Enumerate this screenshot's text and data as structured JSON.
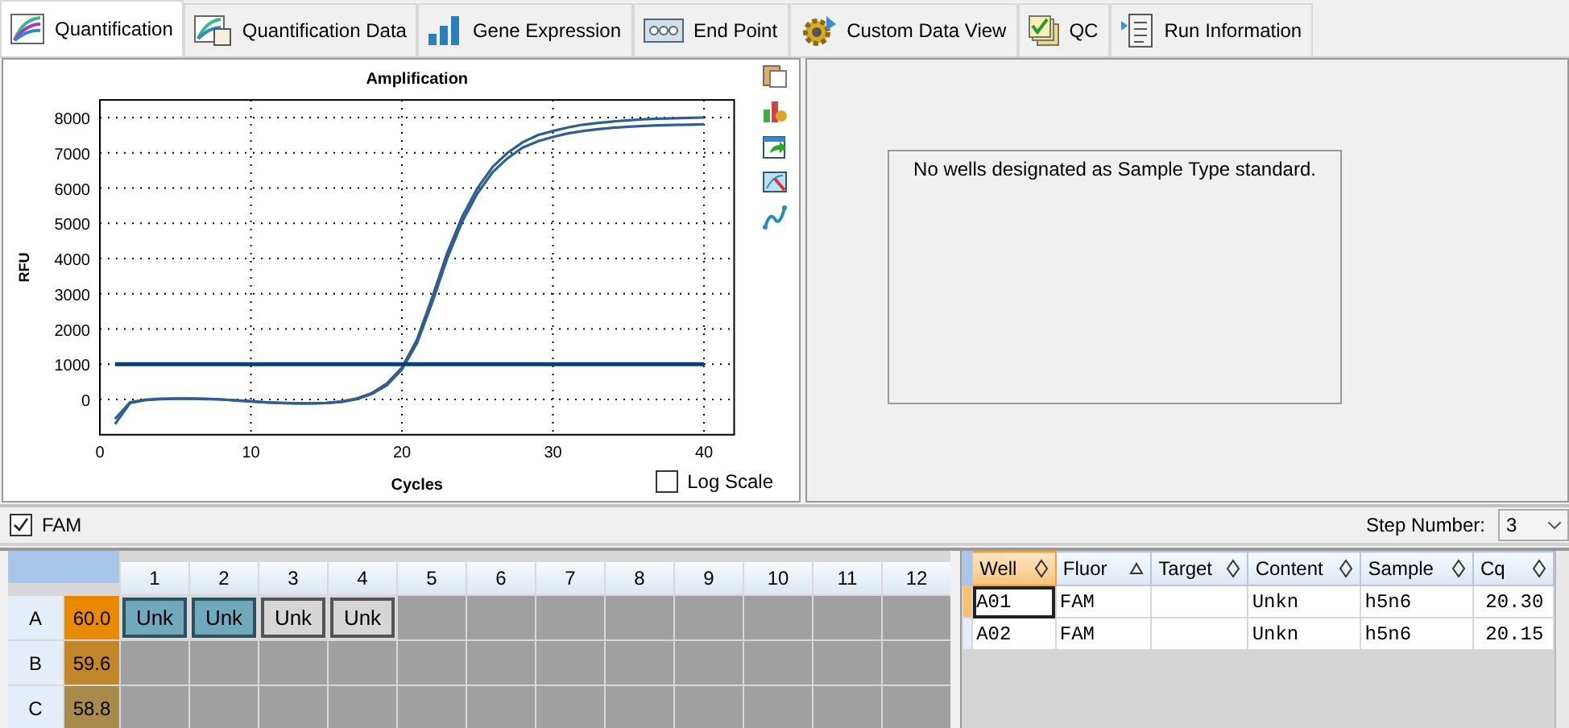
{
  "tabs": [
    {
      "label": "Quantification",
      "selected": true
    },
    {
      "label": "Quantification Data",
      "selected": false
    },
    {
      "label": "Gene Expression",
      "selected": false
    },
    {
      "label": "End Point",
      "selected": false
    },
    {
      "label": "Custom Data View",
      "selected": false
    },
    {
      "label": "QC",
      "selected": false
    },
    {
      "label": "Run Information",
      "selected": false
    }
  ],
  "chart": {
    "log_scale_label": "Log Scale",
    "log_scale": false,
    "chart_data": {
      "type": "line",
      "grid": true,
      "title": "Amplification",
      "xlabel": "Cycles",
      "ylabel": "RFU",
      "xlim": [
        0,
        42
      ],
      "ylim": [
        -1000,
        8500
      ],
      "xticks": [
        0,
        10,
        20,
        30,
        40
      ],
      "yticks": [
        0,
        1000,
        2000,
        3000,
        4000,
        5000,
        6000,
        7000,
        8000
      ],
      "x": [
        1,
        2,
        3,
        4,
        5,
        6,
        7,
        8,
        9,
        10,
        11,
        12,
        13,
        14,
        15,
        16,
        17,
        18,
        19,
        20,
        21,
        22,
        23,
        24,
        25,
        26,
        27,
        28,
        29,
        30,
        31,
        32,
        33,
        34,
        35,
        36,
        37,
        38,
        39,
        40
      ],
      "series": [
        {
          "color": "#2e5f8f",
          "values": [
            -700,
            -100,
            -20,
            10,
            20,
            20,
            10,
            0,
            -30,
            -60,
            -80,
            -100,
            -110,
            -110,
            -100,
            -60,
            30,
            180,
            450,
            900,
            1700,
            2900,
            4150,
            5200,
            6000,
            6600,
            7000,
            7300,
            7500,
            7620,
            7720,
            7800,
            7850,
            7890,
            7920,
            7950,
            7970,
            7980,
            7990,
            8000
          ]
        },
        {
          "color": "#2e5f8f",
          "values": [
            -550,
            -80,
            -10,
            20,
            30,
            30,
            20,
            0,
            -20,
            -50,
            -80,
            -100,
            -110,
            -110,
            -100,
            -70,
            10,
            150,
            400,
            850,
            1600,
            2750,
            4000,
            5050,
            5850,
            6450,
            6850,
            7150,
            7330,
            7450,
            7550,
            7620,
            7670,
            7710,
            7740,
            7760,
            7780,
            7790,
            7800,
            7810
          ]
        },
        {
          "color": "#0b3f78",
          "values": [
            1000,
            1000,
            1000,
            1000,
            1000,
            1000,
            1000,
            1000,
            1000,
            1000,
            1000,
            1000,
            1000,
            1000,
            1000,
            1000,
            1000,
            1000,
            1000,
            1000,
            1000,
            1000,
            1000,
            1000,
            1000,
            1000,
            1000,
            1000,
            1000,
            1000,
            1000,
            1000,
            1000,
            1000,
            1000,
            1000,
            1000,
            1000,
            1000,
            1000
          ]
        }
      ]
    }
  },
  "standard_curve": {
    "message": "No wells designated as Sample Type standard."
  },
  "fluor_filter": {
    "label": "FAM",
    "checked": true
  },
  "step_number": {
    "label": "Step Number:",
    "value": "3"
  },
  "plate": {
    "columns": [
      "1",
      "2",
      "3",
      "4",
      "5",
      "6",
      "7",
      "8",
      "9",
      "10",
      "11",
      "12"
    ],
    "rows": [
      {
        "label": "A",
        "temperature": "60.0",
        "color": "#e88a00",
        "wells": [
          {
            "content": "Unk",
            "selected": true
          },
          {
            "content": "Unk",
            "selected": true
          },
          {
            "content": "Unk",
            "selected": false
          },
          {
            "content": "Unk",
            "selected": false
          }
        ]
      },
      {
        "label": "B",
        "temperature": "59.6",
        "color": "#c4862a",
        "wells": []
      },
      {
        "label": "C",
        "temperature": "58.8",
        "color": "#a88a4c",
        "wells": []
      }
    ]
  },
  "table": {
    "columns": [
      {
        "label": "Well",
        "sorted_ascending": false,
        "selected": true
      },
      {
        "label": "Fluor",
        "sorted_ascending": true,
        "selected": false
      },
      {
        "label": "Target",
        "sorted_ascending": false,
        "selected": false
      },
      {
        "label": "Content",
        "sorted_ascending": false,
        "selected": false
      },
      {
        "label": "Sample",
        "sorted_ascending": false,
        "selected": false
      },
      {
        "label": "Cq",
        "sorted_ascending": false,
        "selected": false
      }
    ],
    "rows": [
      {
        "selected": true,
        "cells": [
          "A01",
          "FAM",
          null,
          "Unkn",
          "h5n6",
          "20.30"
        ]
      },
      {
        "selected": false,
        "cells": [
          "A02",
          "FAM",
          null,
          "Unkn",
          "h5n6",
          "20.15"
        ]
      }
    ]
  }
}
